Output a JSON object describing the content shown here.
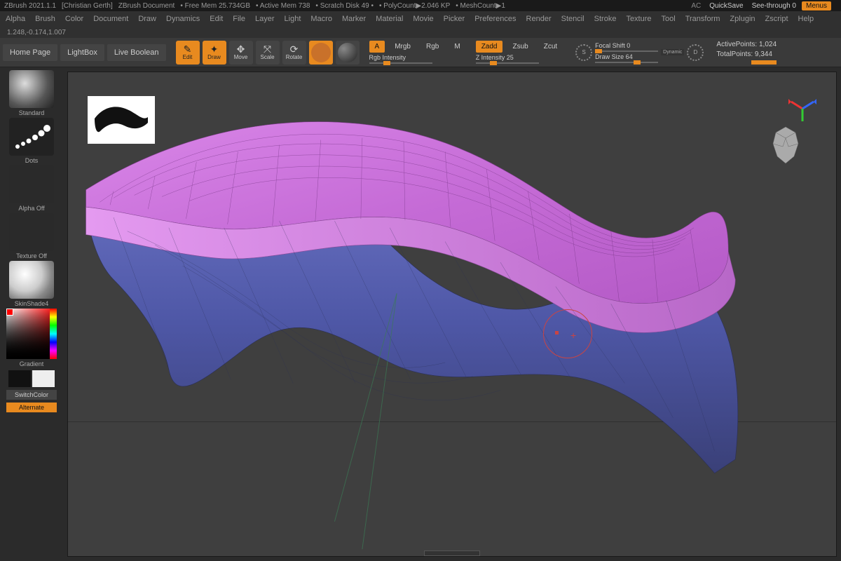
{
  "titlebar": {
    "app": "ZBrush 2021.1.1",
    "user": "[Christian Gerth]",
    "doc": "ZBrush Document",
    "freemem": "• Free Mem 25.734GB",
    "activemem": "• Active Mem 738",
    "scratch": "• Scratch Disk 49 •",
    "polycount": "• PolyCount▶2.046 KP",
    "meshcount": "• MeshCount▶1",
    "ac": "AC",
    "quicksave": "QuickSave",
    "seethrough": "See-through  0",
    "menus": "Menus"
  },
  "menu": {
    "items": [
      "Alpha",
      "Brush",
      "Color",
      "Document",
      "Draw",
      "Dynamics",
      "Edit",
      "File",
      "Layer",
      "Light",
      "Macro",
      "Marker",
      "Material",
      "Movie",
      "Picker",
      "Preferences",
      "Render",
      "Stencil",
      "Stroke",
      "Texture",
      "Tool",
      "Transform",
      "Zplugin",
      "Zscript",
      "Help"
    ]
  },
  "coords": "1.248,-0.174,1.007",
  "toolbar": {
    "tabs": {
      "home": "Home Page",
      "lightbox": "LightBox",
      "live": "Live Boolean"
    },
    "modes": {
      "edit": "Edit",
      "draw": "Draw",
      "move": "Move",
      "scale": "Scale",
      "rotate": "Rotate"
    },
    "a": "A",
    "mrgb": "Mrgb",
    "rgb": "Rgb",
    "m": "M",
    "rgbIntensity": "Rgb Intensity",
    "zadd": "Zadd",
    "zsub": "Zsub",
    "zcut": "Zcut",
    "zintensity": "Z Intensity 25",
    "brushS": "S",
    "brushD": "D",
    "focal": "Focal Shift 0",
    "drawsize": "Draw Size 64",
    "dynamic": "Dynamic",
    "stats": {
      "active": "ActivePoints: 1,024",
      "total": "TotalPoints: 9,344"
    }
  },
  "sidebar": {
    "brush": "Standard",
    "stroke": "Dots",
    "alpha": "Alpha Off",
    "texture": "Texture Off",
    "material": "SkinShade4",
    "gradient": "Gradient",
    "switchcolor": "SwitchColor",
    "alternate": "Alternate"
  }
}
